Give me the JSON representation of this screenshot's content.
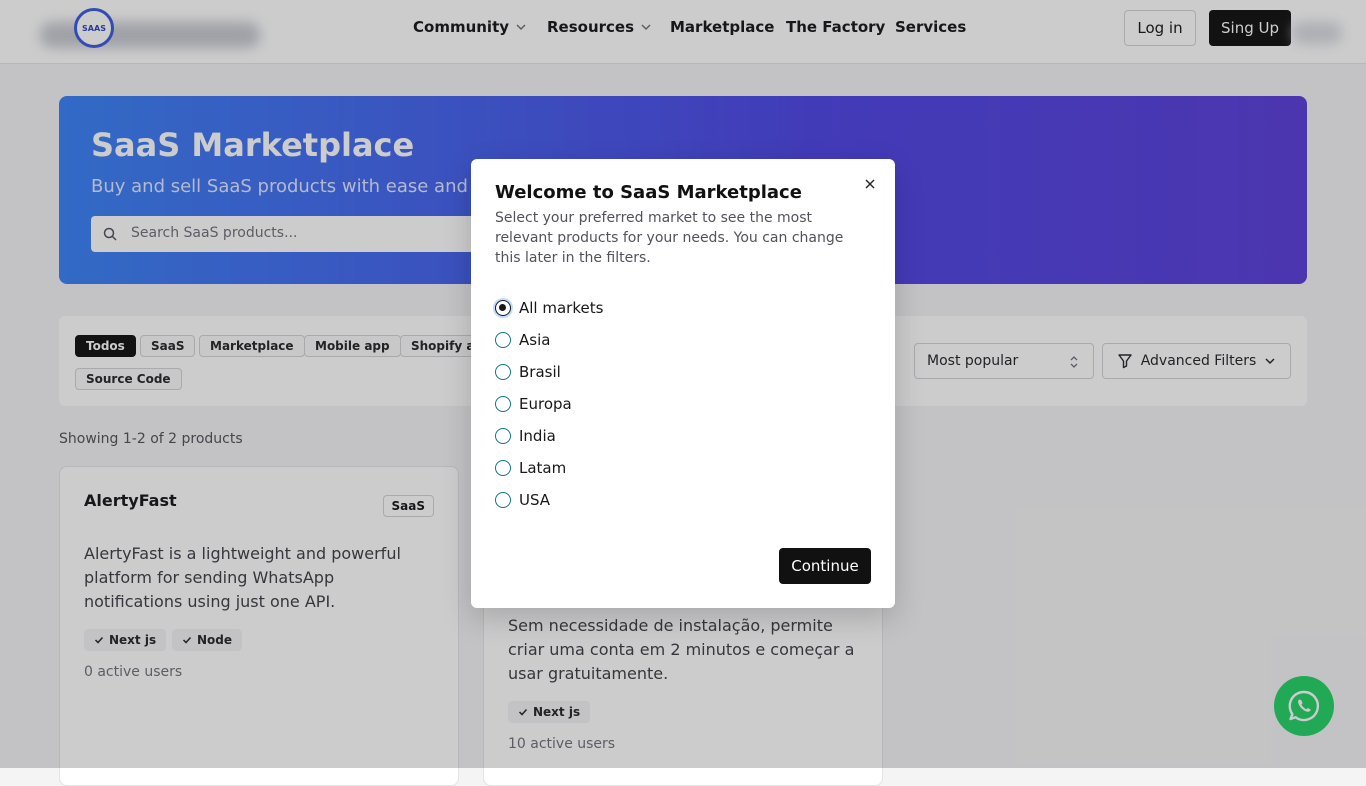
{
  "header": {
    "logo_text": "SAAS",
    "nav": [
      {
        "label": "Community",
        "has_dropdown": true
      },
      {
        "label": "Resources",
        "has_dropdown": true
      },
      {
        "label": "Marketplace",
        "has_dropdown": false
      },
      {
        "label": "The Factory",
        "has_dropdown": false
      },
      {
        "label": "Services",
        "has_dropdown": false
      }
    ],
    "login_label": "Log in",
    "signup_label": "Sing Up"
  },
  "hero": {
    "title": "SaaS Marketplace",
    "subtitle": "Buy and sell SaaS products with ease and con",
    "search_placeholder": "Search SaaS products..."
  },
  "filters": {
    "categories": [
      "Todos",
      "SaaS",
      "Marketplace",
      "Mobile app",
      "Shopify ap",
      "Source Code"
    ],
    "active_category": "Todos",
    "sort_value": "Most popular",
    "advanced_filters_label": "Advanced Filters"
  },
  "results": {
    "showing_text": "Showing 1-2 of 2 products"
  },
  "products": [
    {
      "name": "AlertyFast",
      "type": "SaaS",
      "description": "AlertyFast is a lightweight and powerful platform for sending WhatsApp notifications using just one API.",
      "tech": [
        "Next js",
        "Node"
      ],
      "users": "0 active users"
    },
    {
      "name": "",
      "type": "",
      "description": "Sem necessidade de instalação, permite criar uma conta em 2 minutos e começar a usar gratuitamente.",
      "tech": [
        "Next js"
      ],
      "users": "10 active users"
    }
  ],
  "modal": {
    "title": "Welcome to SaaS Marketplace",
    "description": "Select your preferred market to see the most relevant products for your needs. You can change this later in the filters.",
    "options": [
      "All markets",
      "Asia",
      "Brasil",
      "Europa",
      "India",
      "Latam",
      "USA"
    ],
    "selected": "All markets",
    "continue_label": "Continue"
  },
  "colors": {
    "hero_gradient_start": "#3b82f6",
    "hero_gradient_end": "#5b3fd9",
    "primary_button": "#111111",
    "whatsapp": "#25d366"
  }
}
